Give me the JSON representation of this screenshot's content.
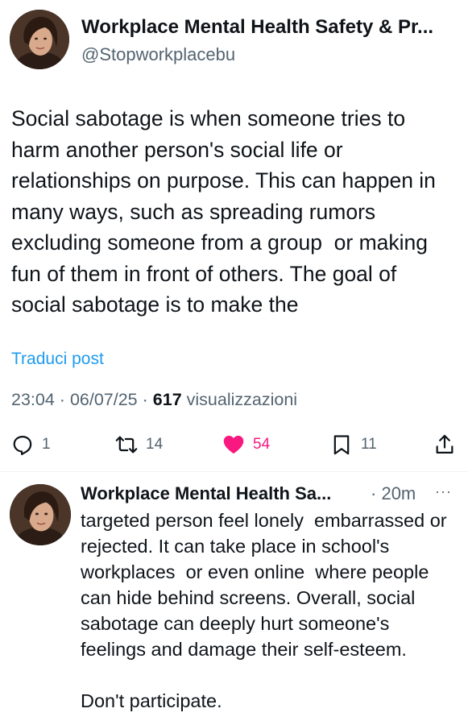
{
  "tweet": {
    "author_name": "Workplace Mental Health Safety & Pr...",
    "handle": "@Stopworkplacebu",
    "text": "Social sabotage is when someone tries to harm another person's social life or relationships on purpose. This can happen in many ways, such as spreading rumors excluding someone from a group  or making fun of them in front of others. The goal of social sabotage is to make the",
    "translate_label": "Traduci post",
    "time": "23:04",
    "date": "06/07/25",
    "views_count": "617",
    "views_label": "visualizzazioni",
    "sep": "·",
    "actions": {
      "replies": "1",
      "reposts": "14",
      "likes": "54",
      "bookmarks": "11"
    }
  },
  "reply": {
    "author_name": "Workplace Mental Health Sa...",
    "time": "20m",
    "sep": "·",
    "more": "···",
    "text": "targeted person feel lonely  embarrassed or rejected. It can take place in school's workplaces  or even online  where people can hide behind screens. Overall, social sabotage can deeply hurt someone's feelings and damage their self-esteem.\n\nDon't participate."
  },
  "colors": {
    "text": "#0f1419",
    "secondary": "#536471",
    "link": "#1d9bf0",
    "like": "#f91880"
  },
  "icons": [
    "avatar",
    "reply-icon",
    "repost-icon",
    "heart-icon",
    "bookmark-icon",
    "share-icon",
    "more-icon"
  ]
}
